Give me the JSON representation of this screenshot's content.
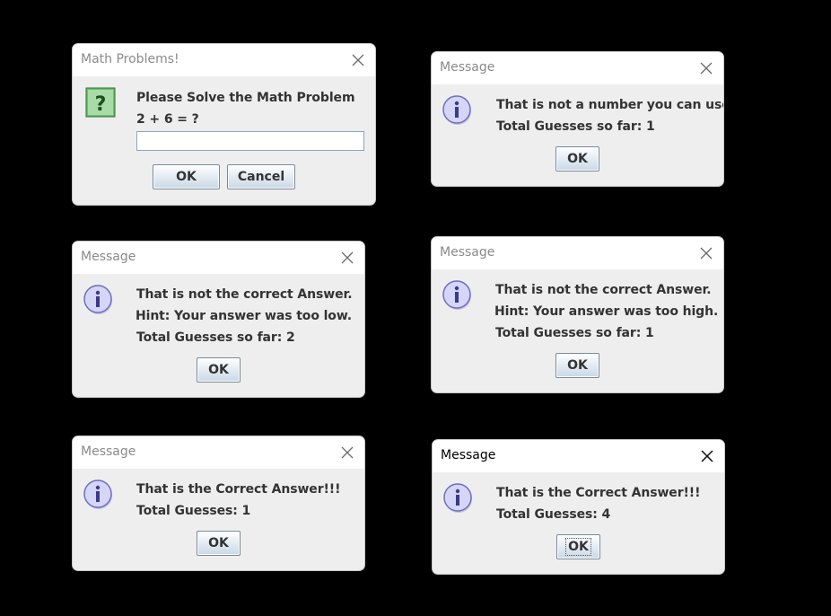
{
  "dialogs": {
    "math": {
      "title": "Math Problems!",
      "prompt": "Please Solve the Math Problem",
      "question": "2 + 6 = ?",
      "input_value": "",
      "ok": "OK",
      "cancel": "Cancel",
      "icon": "question-icon",
      "icon_color": "#3c8c3c"
    },
    "not_number": {
      "title": "Message",
      "line1": "That is not a number you can use!!",
      "line2": "Total Guesses so far: 1",
      "ok": "OK",
      "icon": "info-icon"
    },
    "too_low": {
      "title": "Message",
      "line1": "That is not the correct Answer.",
      "line2": "Hint: Your answer was too low.",
      "line3": "Total Guesses so far: 2",
      "ok": "OK",
      "icon": "info-icon"
    },
    "too_high": {
      "title": "Message",
      "line1": "That is not the correct Answer.",
      "line2": "Hint: Your answer was too high.",
      "line3": "Total Guesses so far: 1",
      "ok": "OK",
      "icon": "info-icon"
    },
    "correct_1": {
      "title": "Message",
      "line1": "That is the Correct Answer!!!",
      "line2": "Total Guesses: 1",
      "ok": "OK",
      "icon": "info-icon"
    },
    "correct_4": {
      "title": "Message",
      "line1": "That is the Correct Answer!!!",
      "line2": "Total Guesses: 4",
      "ok": "OK",
      "icon": "info-icon"
    }
  },
  "colors": {
    "background": "#000000",
    "dialog_body": "#eeeeee",
    "titlebar": "#ffffff",
    "info_icon_fill": "#c7c7f2",
    "info_icon_stroke": "#6d6dbf"
  }
}
